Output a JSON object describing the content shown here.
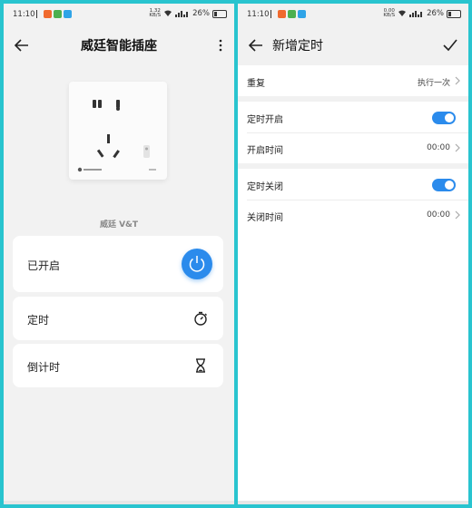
{
  "status_bar_left": {
    "time": "11:10",
    "speed": "1.32\nKB/S",
    "battery": "26%"
  },
  "status_bar_right": {
    "time": "11:10",
    "speed": "0.00\nKB/S",
    "battery": "26%"
  },
  "left_screen": {
    "title": "威廷智能插座",
    "device_name": "威廷 V&T",
    "power_card": {
      "label": "已开启"
    },
    "timer_card": {
      "label": "定时"
    },
    "countdown_card": {
      "label": "倒计时"
    }
  },
  "right_screen": {
    "title": "新增定时",
    "repeat": {
      "label": "重复",
      "value": "执行一次"
    },
    "timed_on": {
      "label": "定时开启",
      "enabled": true
    },
    "on_time": {
      "label": "开启时间",
      "value": "00:00"
    },
    "timed_off": {
      "label": "定时关闭",
      "enabled": true
    },
    "off_time": {
      "label": "关闭时间",
      "value": "00:00"
    }
  },
  "colors": {
    "accent": "#2b8bec",
    "frame": "#29c4cf"
  },
  "icons": [
    "back-arrow-icon",
    "more-vertical-icon",
    "power-icon",
    "stopwatch-icon",
    "hourglass-icon",
    "checkmark-icon",
    "chevron-right-icon"
  ]
}
